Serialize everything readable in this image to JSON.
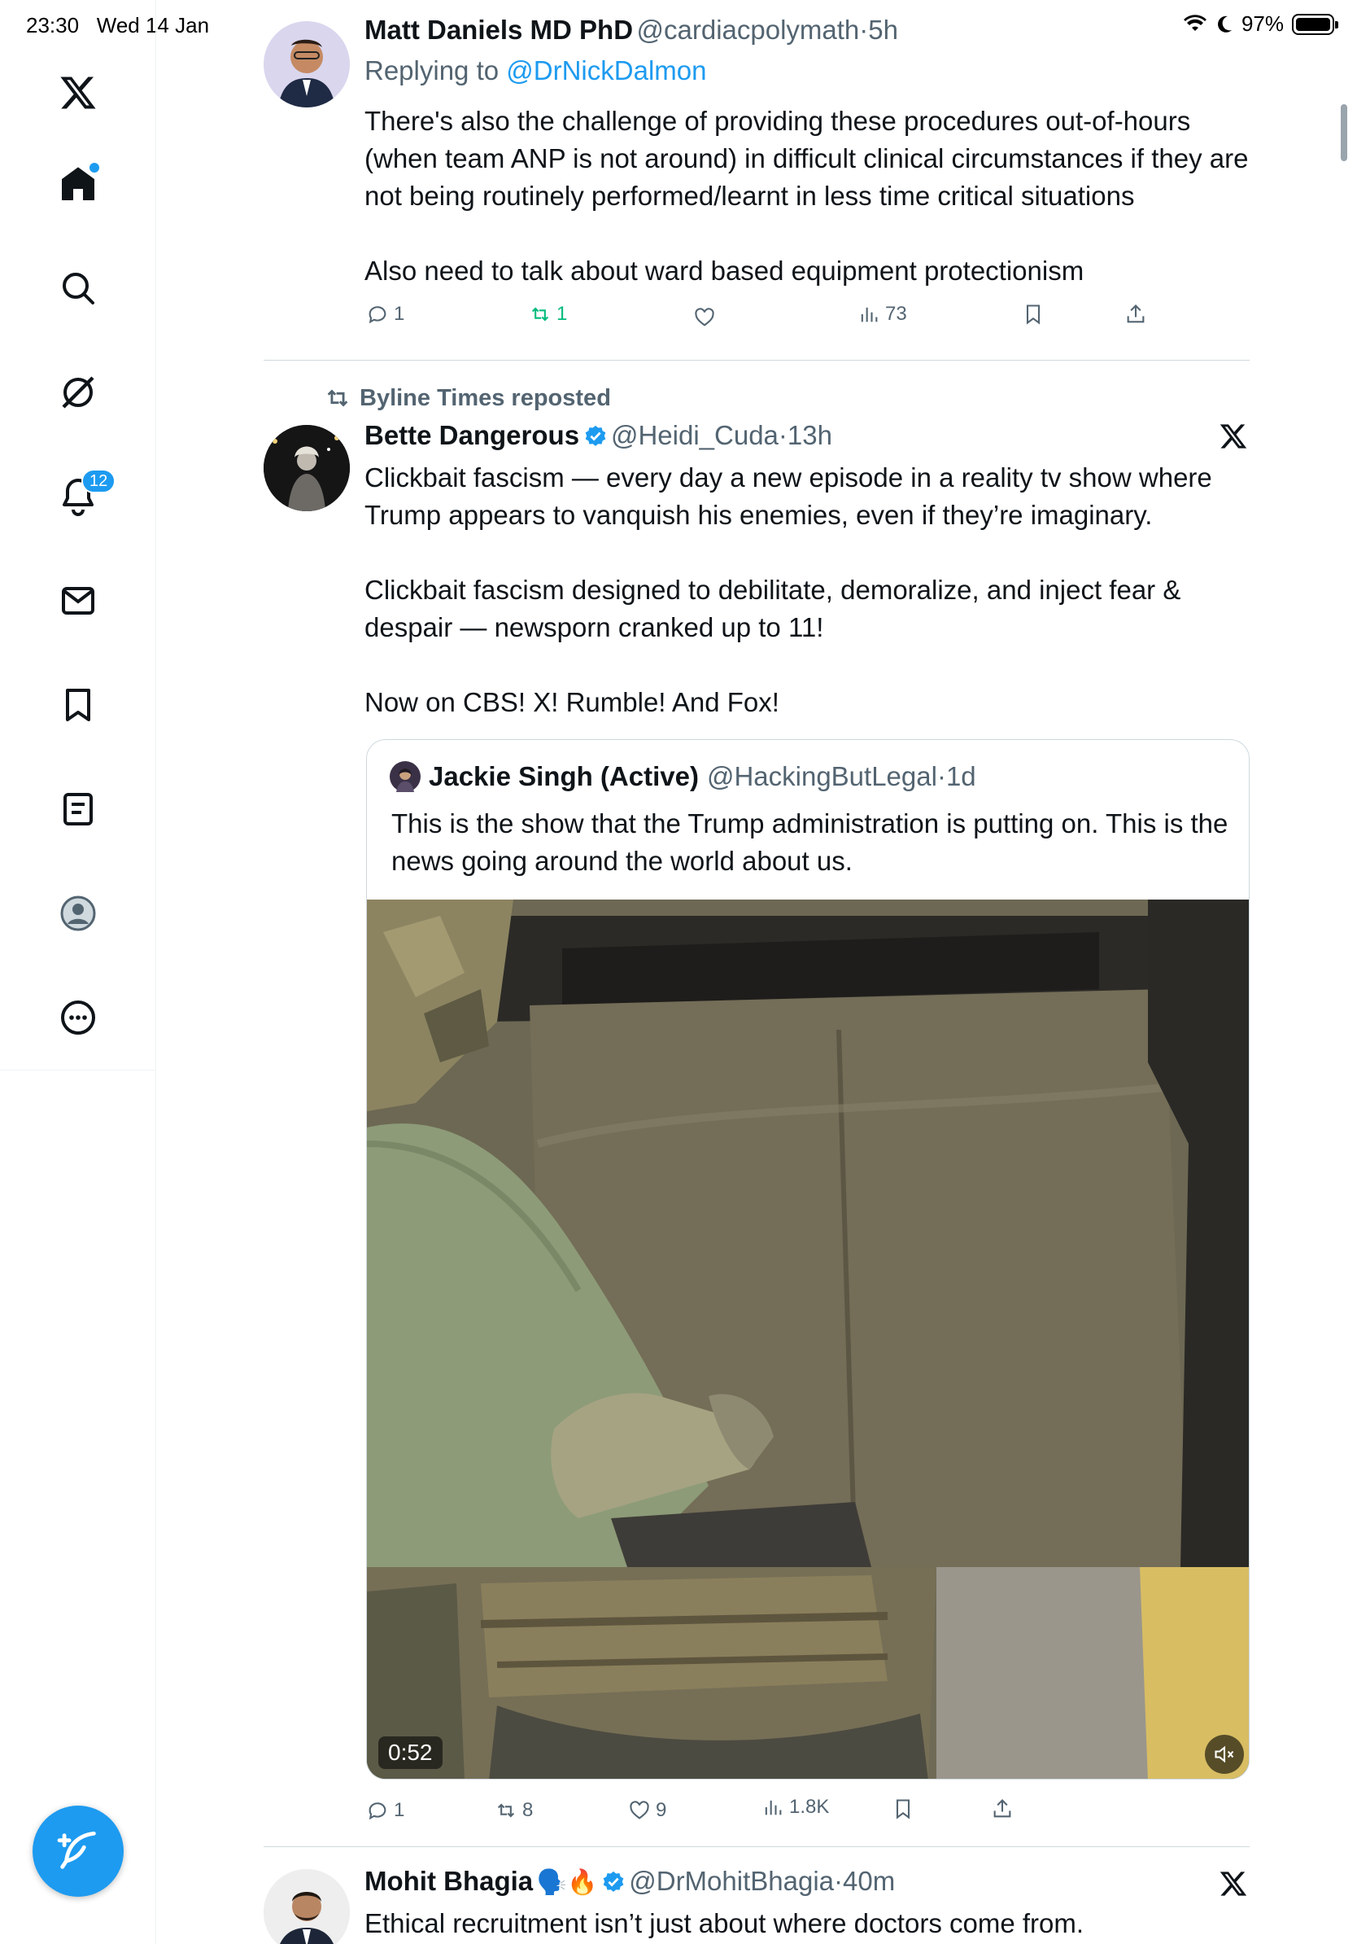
{
  "status_bar": {
    "time": "23:30",
    "date": "Wed 14 Jan",
    "battery": "97%"
  },
  "sidebar": {
    "notifications_badge": "12",
    "items": [
      {
        "name": "x-logo-icon"
      },
      {
        "name": "home-icon"
      },
      {
        "name": "search-icon"
      },
      {
        "name": "grok-icon"
      },
      {
        "name": "notifications-icon"
      },
      {
        "name": "messages-icon"
      },
      {
        "name": "bookmarks-icon"
      },
      {
        "name": "lists-icon"
      },
      {
        "name": "profile-icon"
      },
      {
        "name": "more-icon"
      }
    ],
    "compose": {
      "icon": "compose-icon"
    }
  },
  "tweets": [
    {
      "author_name": "Matt Daniels MD PhD",
      "handle": "@cardiacpolymath",
      "time": "5h",
      "replying_to_label": "Replying to",
      "replying_to_handle": "@DrNickDalmon",
      "text_p1": "There's also the challenge of providing these procedures out-of-hours (when team ANP is not around) in difficult clinical circumstances if they are not being routinely performed/learnt in less time critical situations",
      "text_p2": "Also need to talk about ward based equipment protectionism",
      "replies": "1",
      "reposts": "1",
      "likes": "",
      "views": "73"
    },
    {
      "repost_label": "Byline Times reposted",
      "author_name": "Bette Dangerous",
      "handle": "@Heidi_Cuda",
      "time": "13h",
      "text_p1": "Clickbait fascism — every day a new episode in a reality tv show where Trump appears to vanquish his enemies, even if they’re imaginary.",
      "text_p2": "Clickbait fascism designed to debilitate, demoralize, and inject fear & despair — newsporn cranked up to 11!",
      "text_p3": "Now on CBS! X! Rumble! And Fox!",
      "quote": {
        "author_name": "Jackie Singh (Active)",
        "handle": "@HackingButLegal",
        "time": "1d",
        "text": "This is the show that the Trump administration is putting on. This is the news going around the world about us.",
        "video_duration": "0:52"
      },
      "replies": "1",
      "reposts": "8",
      "likes": "9",
      "views": "1.8K"
    },
    {
      "author_name": "Mohit Bhagia",
      "name_emojis": "🗣️🔥",
      "handle": "@DrMohitBhagia",
      "time": "40m",
      "text_p1": "Ethical recruitment isn’t just about where doctors come from."
    }
  ],
  "colors": {
    "accent": "#1d9bf0",
    "repost_green": "#00ba7c",
    "secondary_text": "#536471",
    "link": "#1d9bf0"
  }
}
